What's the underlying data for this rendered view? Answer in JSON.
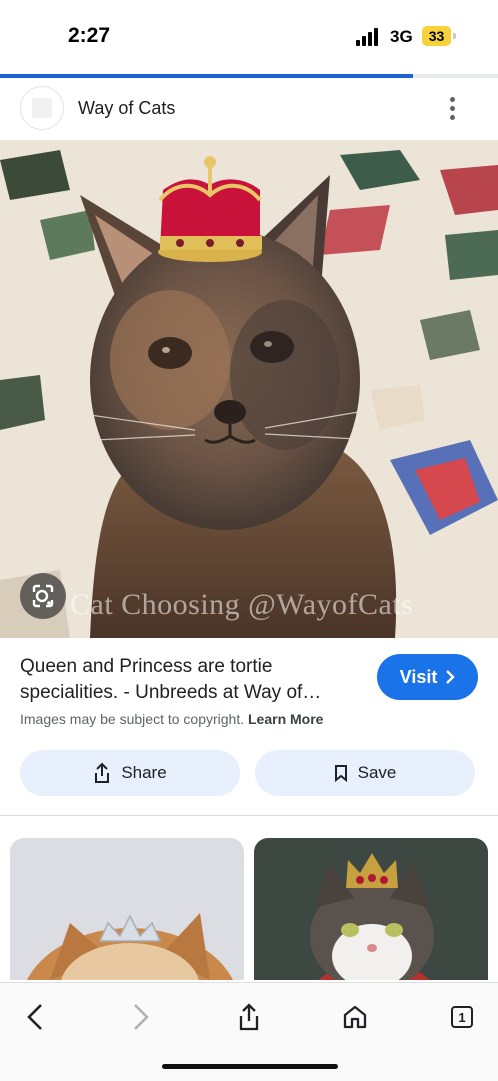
{
  "status_bar": {
    "time": "2:27",
    "network": "3G",
    "battery": "33"
  },
  "page_load_progress": 0.83,
  "site": {
    "name": "Way of Cats"
  },
  "image": {
    "watermark": "Cat Choosing @WayofCats"
  },
  "result": {
    "title_line1": "Queen and Princess are tortie",
    "title_line2": "specialities. - Unbreeds at Way of…",
    "visit_label": "Visit",
    "copyright_text": "Images may be subject to copyright.",
    "learn_more": "Learn More"
  },
  "actions": {
    "share_label": "Share",
    "save_label": "Save"
  },
  "toolbar": {
    "tab_count": "1"
  },
  "icons": [
    "google-lens-icon",
    "more-vert-icon",
    "chevron-right-icon",
    "share-icon",
    "bookmark-icon",
    "back-icon",
    "forward-icon",
    "home-icon",
    "tabs-icon"
  ],
  "colors": {
    "accent": "#1a73e8",
    "progress": "#1a66d2",
    "chip_bg": "#e8f0fe"
  }
}
